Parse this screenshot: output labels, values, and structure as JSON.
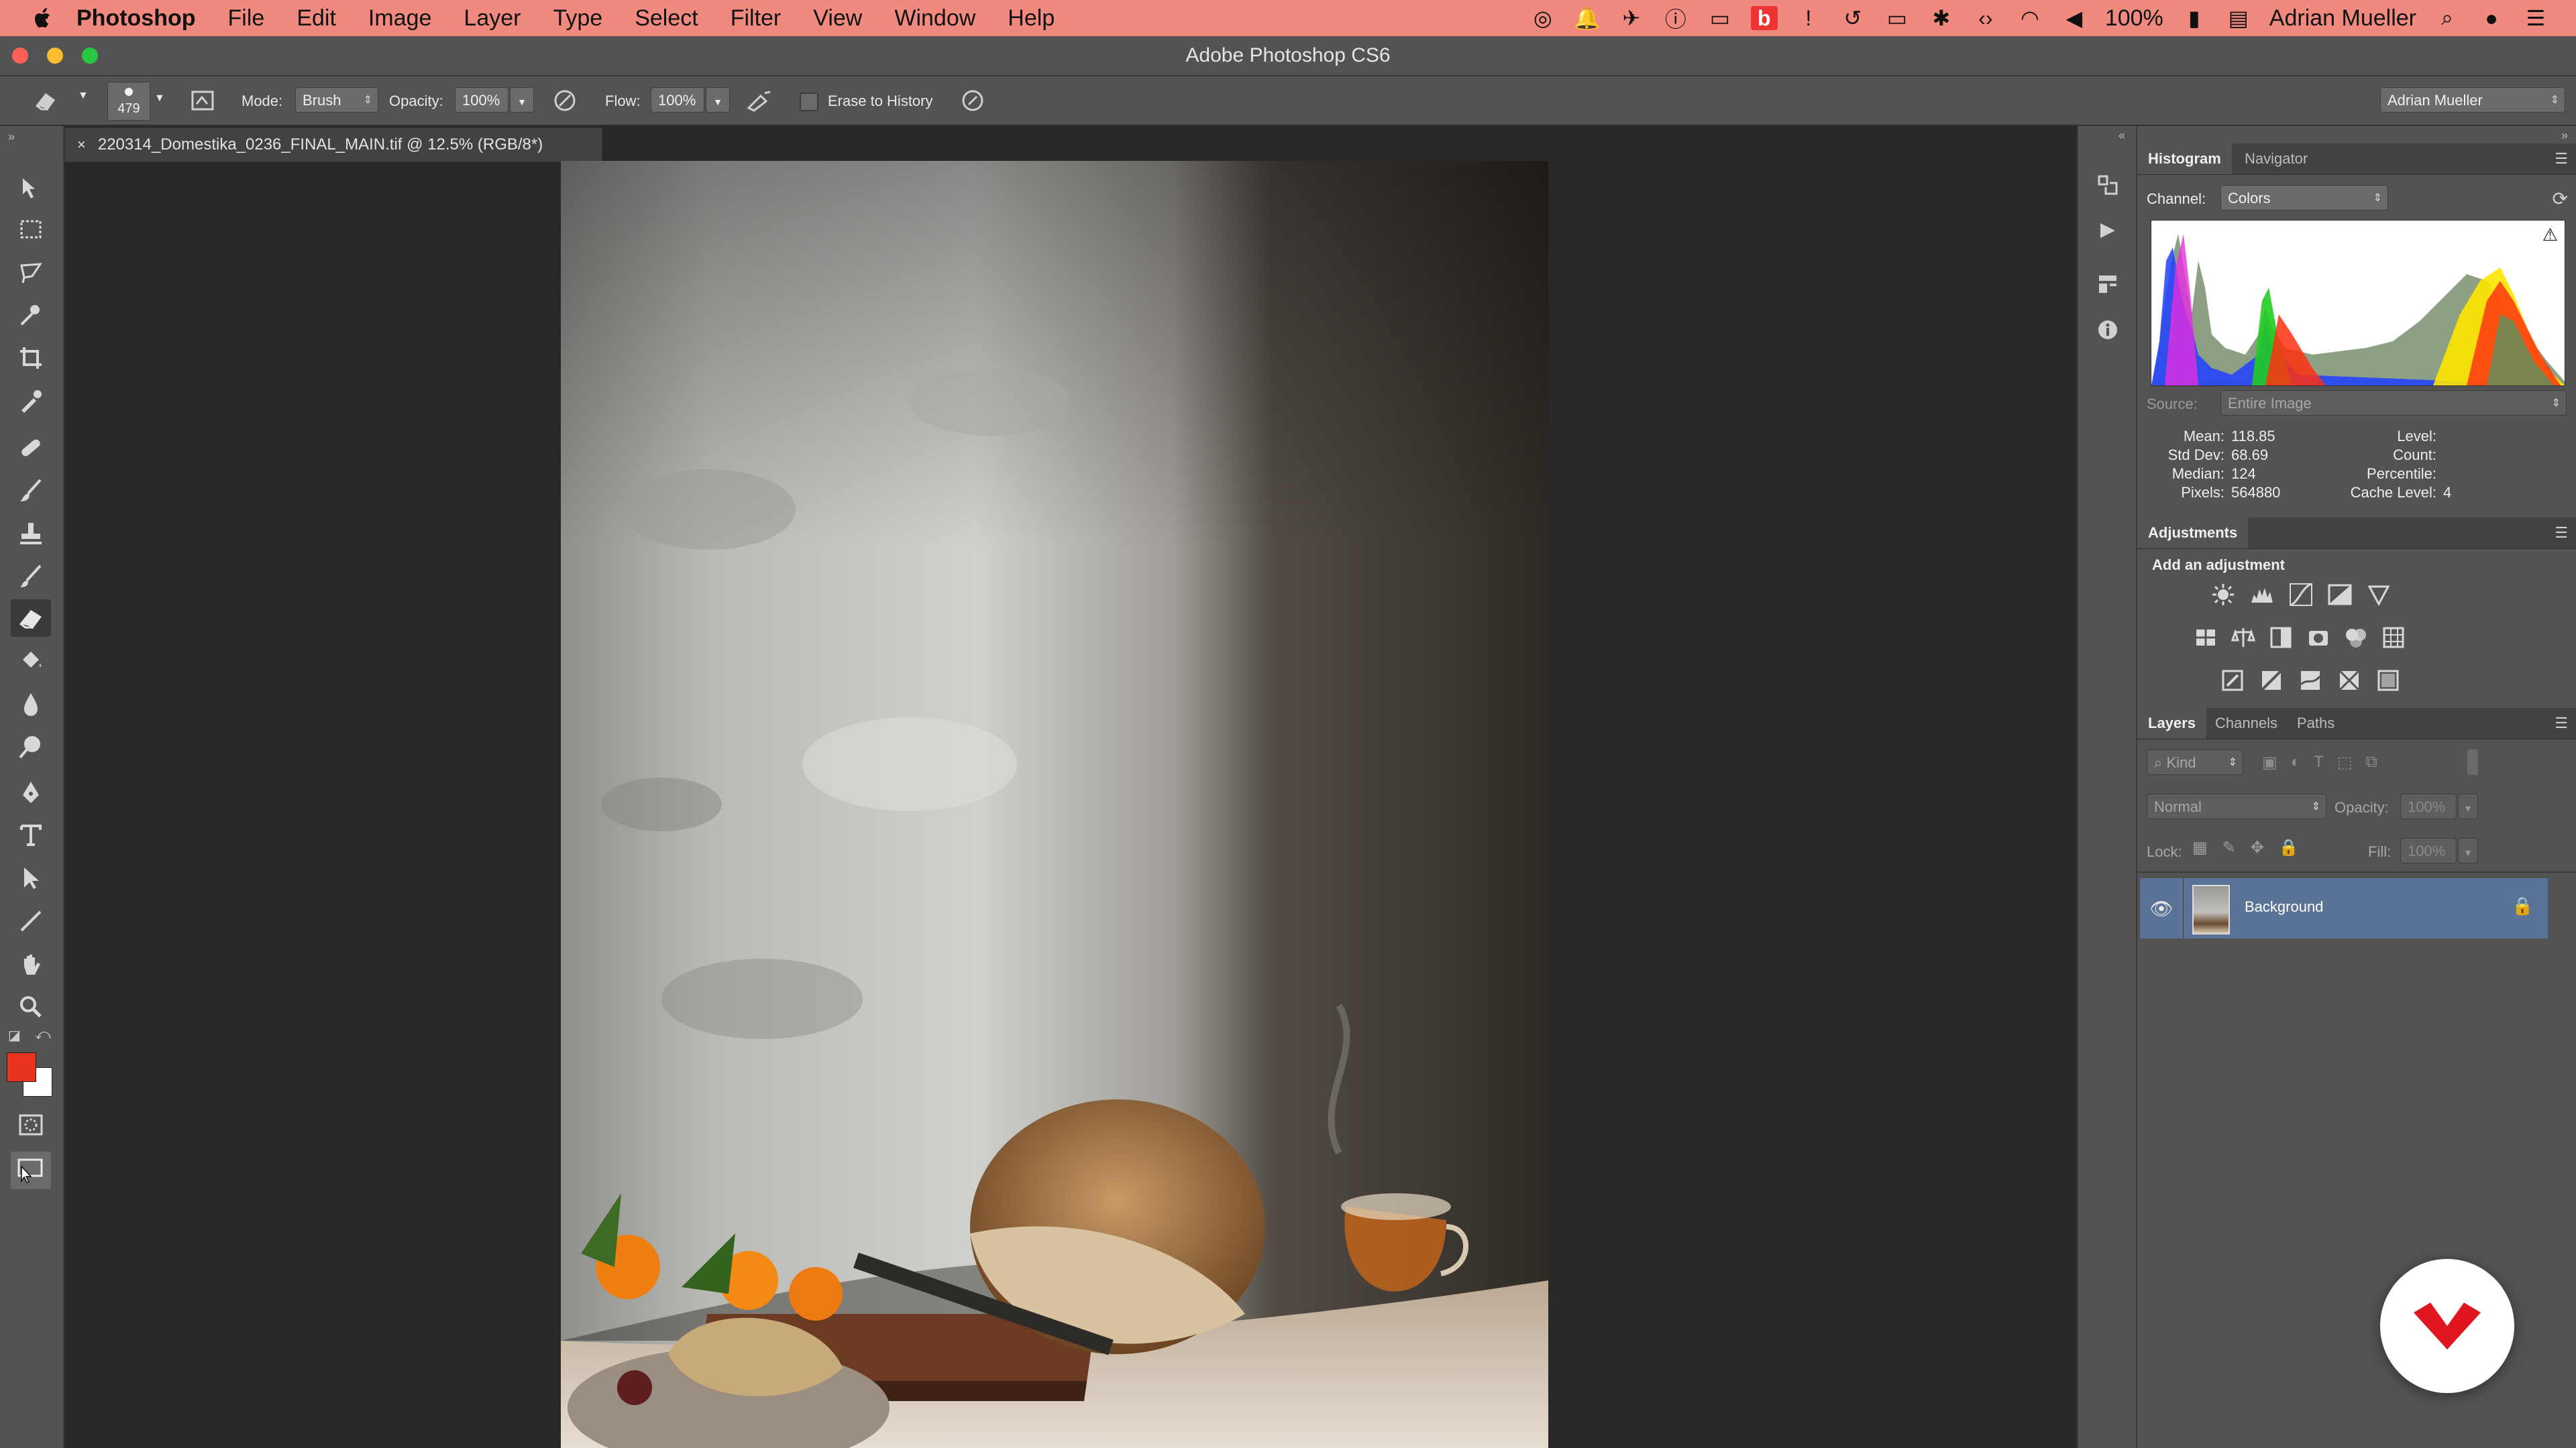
{
  "menubar": {
    "app_name": "Photoshop",
    "items": [
      "File",
      "Edit",
      "Image",
      "Layer",
      "Type",
      "Select",
      "Filter",
      "View",
      "Window",
      "Help"
    ],
    "battery": "100%",
    "user": "Adrian Mueller"
  },
  "window": {
    "title": "Adobe Photoshop CS6"
  },
  "options": {
    "brush_size": "479",
    "mode_label": "Mode:",
    "mode_value": "Brush",
    "opacity_label": "Opacity:",
    "opacity_value": "100%",
    "flow_label": "Flow:",
    "flow_value": "100%",
    "erase_history_label": "Erase to History",
    "workspace": "Adrian Mueller"
  },
  "document": {
    "tab_title": "220314_Domestika_0236_FINAL_MAIN.tif @ 12.5% (RGB/8*)"
  },
  "colors": {
    "foreground": "#e8321e",
    "background": "#ffffff",
    "menubar": "#f08a7e",
    "selected_layer": "#5a7397"
  },
  "histogram": {
    "tabs": [
      "Histogram",
      "Navigator"
    ],
    "channel_label": "Channel:",
    "channel_value": "Colors",
    "source_label": "Source:",
    "source_value": "Entire Image",
    "stats_left": [
      {
        "label": "Mean:",
        "value": "118.85"
      },
      {
        "label": "Std Dev:",
        "value": "68.69"
      },
      {
        "label": "Median:",
        "value": "124"
      },
      {
        "label": "Pixels:",
        "value": "564880"
      }
    ],
    "stats_right": [
      {
        "label": "Level:",
        "value": ""
      },
      {
        "label": "Count:",
        "value": ""
      },
      {
        "label": "Percentile:",
        "value": ""
      },
      {
        "label": "Cache Level:",
        "value": "4"
      }
    ]
  },
  "adjustments": {
    "tab": "Adjustments",
    "heading": "Add an adjustment"
  },
  "layers": {
    "tabs": [
      "Layers",
      "Channels",
      "Paths"
    ],
    "kind": "Kind",
    "blend_mode": "Normal",
    "opacity_label": "Opacity:",
    "opacity_value": "100%",
    "lock_label": "Lock:",
    "fill_label": "Fill:",
    "fill_value": "100%",
    "items": [
      {
        "name": "Background",
        "visible": true,
        "locked": true,
        "selected": true
      }
    ]
  },
  "icons": {
    "tools": [
      "move-icon",
      "marquee-icon",
      "lasso-icon",
      "quick-select-icon",
      "crop-icon",
      "eyedropper-icon",
      "healing-brush-icon",
      "brush-icon",
      "clone-stamp-icon",
      "history-brush-icon",
      "eraser-icon",
      "paint-bucket-icon",
      "blur-icon",
      "dodge-icon",
      "pen-icon",
      "type-icon",
      "path-select-icon",
      "line-icon",
      "hand-icon",
      "zoom-icon"
    ]
  }
}
